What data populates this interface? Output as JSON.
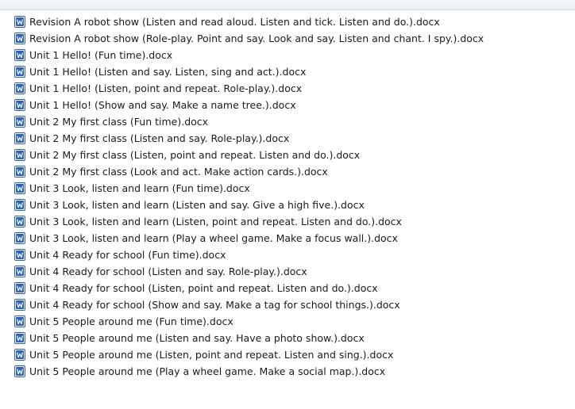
{
  "file_list": {
    "icon": "word-document-icon",
    "accent_color": "#2b63b8",
    "items": [
      {
        "name": "Revision A robot show (Listen and read aloud. Listen and tick. Listen and do.).docx"
      },
      {
        "name": "Revision A robot show (Role-play. Point and say. Look and say. Listen and chant. I spy.).docx"
      },
      {
        "name": "Unit 1 Hello! (Fun time).docx"
      },
      {
        "name": "Unit 1 Hello! (Listen and say. Listen, sing and act.).docx"
      },
      {
        "name": "Unit 1 Hello! (Listen, point and repeat. Role-play.).docx"
      },
      {
        "name": "Unit 1 Hello! (Show and say. Make a name tree.).docx"
      },
      {
        "name": "Unit 2 My first class (Fun time).docx"
      },
      {
        "name": "Unit 2 My first class (Listen and say. Role-play.).docx"
      },
      {
        "name": "Unit 2 My first class (Listen, point and repeat. Listen and do.).docx"
      },
      {
        "name": "Unit 2 My first class (Look and act. Make action cards.).docx"
      },
      {
        "name": "Unit 3 Look, listen and learn (Fun time).docx"
      },
      {
        "name": "Unit 3 Look, listen and learn (Listen and say. Give a high five.).docx"
      },
      {
        "name": "Unit 3 Look, listen and learn (Listen, point and repeat. Listen and do.).docx"
      },
      {
        "name": "Unit 3 Look, listen and learn (Play a wheel game. Make a focus wall.).docx"
      },
      {
        "name": "Unit 4 Ready for school (Fun time).docx"
      },
      {
        "name": "Unit 4 Ready for school (Listen and say. Role-play.).docx"
      },
      {
        "name": "Unit 4 Ready for school (Listen, point and repeat. Listen and do.).docx"
      },
      {
        "name": "Unit 4 Ready for school (Show and say. Make a tag for school things.).docx"
      },
      {
        "name": "Unit 5 People around me (Fun time).docx"
      },
      {
        "name": "Unit 5 People around me (Listen and say. Have a photo show.).docx"
      },
      {
        "name": "Unit 5 People around me (Listen, point and repeat. Listen and sing.).docx"
      },
      {
        "name": "Unit 5 People around me (Play a wheel game. Make a social map.).docx"
      }
    ]
  }
}
